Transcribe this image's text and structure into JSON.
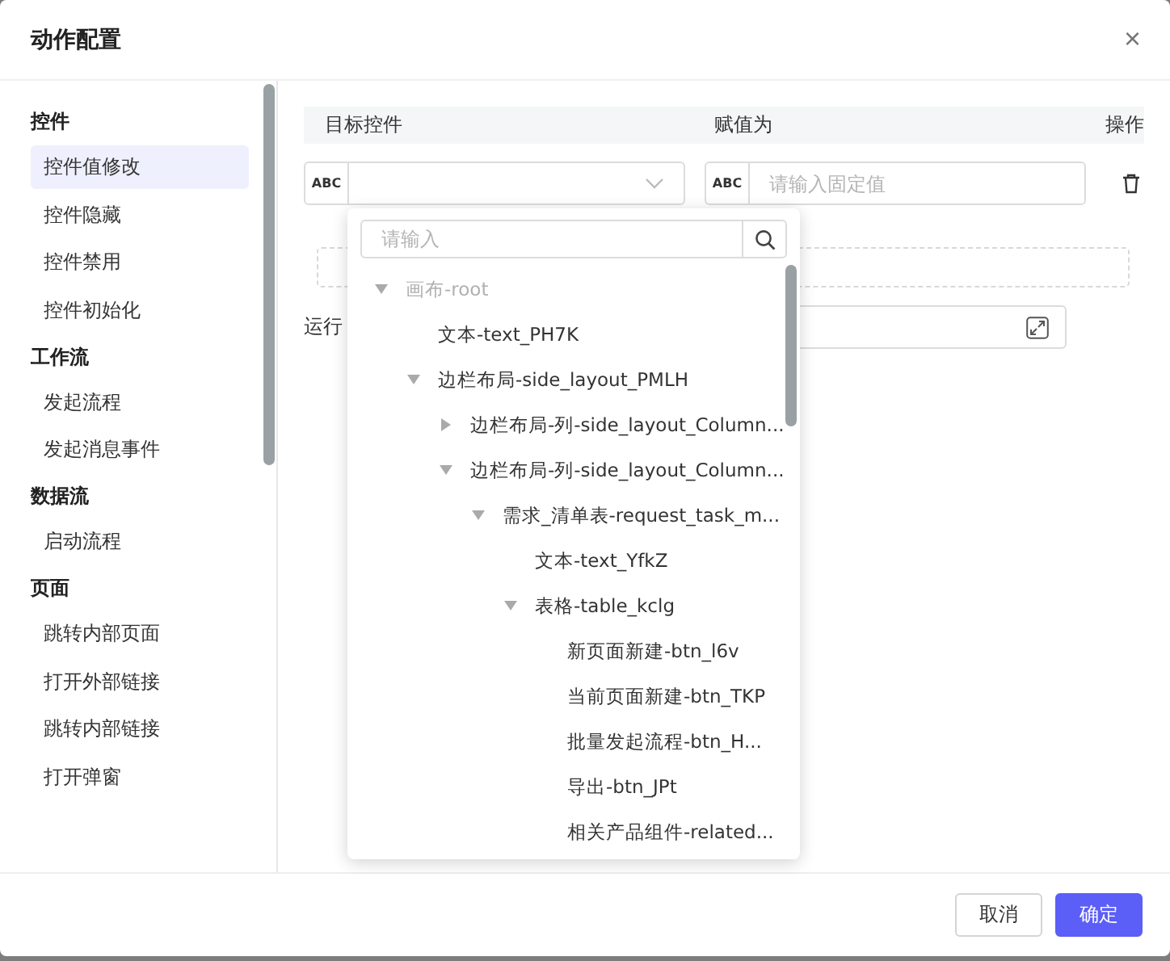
{
  "dialog": {
    "title": "动作配置",
    "close": "×"
  },
  "sidebar": {
    "groups": [
      {
        "heading": "控件",
        "items": [
          {
            "label": "控件值修改",
            "selected": true
          },
          {
            "label": "控件隐藏",
            "selected": false
          },
          {
            "label": "控件禁用",
            "selected": false
          },
          {
            "label": "控件初始化",
            "selected": false
          }
        ]
      },
      {
        "heading": "工作流",
        "items": [
          {
            "label": "发起流程",
            "selected": false
          },
          {
            "label": "发起消息事件",
            "selected": false
          }
        ]
      },
      {
        "heading": "数据流",
        "items": [
          {
            "label": "启动流程",
            "selected": false
          }
        ]
      },
      {
        "heading": "页面",
        "items": [
          {
            "label": "跳转内部页面",
            "selected": false
          },
          {
            "label": "打开外部链接",
            "selected": false
          },
          {
            "label": "跳转内部链接",
            "selected": false
          },
          {
            "label": "打开弹窗",
            "selected": false
          }
        ]
      }
    ]
  },
  "table": {
    "columns": [
      "目标控件",
      "赋值为",
      "操作"
    ],
    "row": {
      "target_prefix": "ABC",
      "value_prefix": "ABC",
      "value_placeholder": "请输入固定值"
    }
  },
  "run_label": "运行",
  "dropdown": {
    "search_placeholder": "请输入",
    "tree": [
      {
        "label": "画布-root",
        "disabled": true,
        "expanded": true,
        "children": [
          {
            "label": "文本-text_PH7K",
            "disabled": false
          },
          {
            "label": "边栏布局-side_layout_PMLH",
            "disabled": false,
            "expanded": true,
            "children": [
              {
                "label": "边栏布局-列-side_layout_Column...",
                "disabled": false,
                "expanded": false
              },
              {
                "label": "边栏布局-列-side_layout_Column...",
                "disabled": false,
                "expanded": true,
                "children": [
                  {
                    "label": "需求_清单表-request_task_m...",
                    "disabled": false,
                    "expanded": true,
                    "children": [
                      {
                        "label": "文本-text_YfkZ",
                        "disabled": false
                      },
                      {
                        "label": "表格-table_kclg",
                        "disabled": false,
                        "expanded": true,
                        "children": [
                          {
                            "label": "新页面新建-btn_l6v",
                            "disabled": false
                          },
                          {
                            "label": "当前页面新建-btn_TKP",
                            "disabled": false
                          },
                          {
                            "label": "批量发起流程-btn_H...",
                            "disabled": false
                          },
                          {
                            "label": "导出-btn_JPt",
                            "disabled": false
                          },
                          {
                            "label": "相关产品组件-related...",
                            "disabled": false
                          }
                        ]
                      }
                    ]
                  }
                ]
              }
            ]
          }
        ]
      }
    ]
  },
  "footer": {
    "buttons": [
      {
        "label": "取消",
        "kind": "secondary"
      },
      {
        "label": "确定",
        "kind": "primary"
      }
    ]
  }
}
